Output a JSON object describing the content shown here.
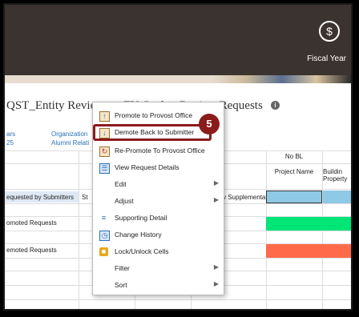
{
  "header": {
    "fiscal_year_label": "Fiscal Year",
    "fiscal_icon": "dollar-sign-icon"
  },
  "page": {
    "title": "QST_Entity Reviewer - FY Cycle - Review Requests"
  },
  "meta": {
    "col1_line1": "ars",
    "col1_line2": "25",
    "col2_line1": "Organization",
    "col2_line2": "Alumni Relati"
  },
  "grid": {
    "group_header": "No BL",
    "col_project_name": "Project Name",
    "col_building_l1": "Buildin",
    "col_building_l2": "Property",
    "truncated_st": "St",
    "rows": [
      "equested by Submitters",
      "omoted Requests",
      "emoted Requests"
    ],
    "supplemental": "v Supplemental",
    "colors": {
      "selected": "#8ecae6",
      "promoted": "#00e676",
      "demoted": "#ff6b4a"
    }
  },
  "context_menu": {
    "items": [
      {
        "label": "Promote to Provost Office",
        "icon": "promote-icon",
        "submenu": false
      },
      {
        "label": "Demote Back to Submitter",
        "icon": "demote-icon",
        "submenu": false
      },
      {
        "label": "Re-Promote To Provost Office",
        "icon": "repromote-icon",
        "submenu": false
      },
      {
        "label": "View Request Details",
        "icon": "details-icon",
        "submenu": false
      },
      {
        "label": "Edit",
        "icon": "",
        "submenu": true
      },
      {
        "label": "Adjust",
        "icon": "",
        "submenu": true
      },
      {
        "label": "Supporting Detail",
        "icon": "supporting-detail-icon",
        "submenu": false
      },
      {
        "label": "Change History",
        "icon": "change-history-icon",
        "submenu": false
      },
      {
        "label": "Lock/Unlock Cells",
        "icon": "lock-icon",
        "submenu": false
      },
      {
        "label": "Filter",
        "icon": "",
        "submenu": true
      },
      {
        "label": "Sort",
        "icon": "",
        "submenu": true
      }
    ]
  },
  "callout": {
    "step": "5"
  }
}
